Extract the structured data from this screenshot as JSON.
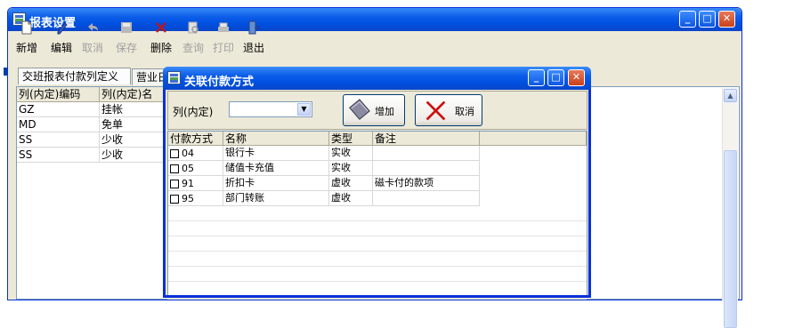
{
  "main_window": {
    "title": "报表设置",
    "toolbar": [
      {
        "label": "新增",
        "icon": "new-file-icon",
        "enabled": true
      },
      {
        "label": "编辑",
        "icon": "edit-pen-icon",
        "enabled": true
      },
      {
        "label": "取消",
        "icon": "undo-icon",
        "enabled": false
      },
      {
        "label": "保存",
        "icon": "save-disk-icon",
        "enabled": false
      },
      {
        "label": "删除",
        "icon": "delete-x-icon",
        "enabled": true
      },
      {
        "label": "查询",
        "icon": "query-icon",
        "enabled": false
      },
      {
        "label": "打印",
        "icon": "printer-icon",
        "enabled": false
      },
      {
        "label": "退出",
        "icon": "exit-door-icon",
        "enabled": true
      }
    ],
    "tabs": [
      "交班报表付款列定义",
      "营业日"
    ],
    "grid": {
      "columns": [
        "列(内定)编码",
        "列(内定)名"
      ],
      "rows": [
        [
          "GZ",
          "挂帐"
        ],
        [
          "MD",
          "免单"
        ],
        [
          "SS",
          "少收"
        ],
        [
          "SS",
          "少收"
        ]
      ]
    }
  },
  "dialog": {
    "title": "关联付款方式",
    "filter_label": "列(内定)",
    "filter_value": "",
    "add_label": "增加",
    "cancel_label": "取消",
    "grid": {
      "columns": [
        "付款方式",
        "名称",
        "类型",
        "备注"
      ],
      "rows": [
        {
          "code": "04",
          "name": "银行卡",
          "type": "实收",
          "note": ""
        },
        {
          "code": "05",
          "name": "储值卡充值",
          "type": "实收",
          "note": ""
        },
        {
          "code": "91",
          "name": "折扣卡",
          "type": "虚收",
          "note": "磁卡付的款项"
        },
        {
          "code": "95",
          "name": "部门转账",
          "type": "虚收",
          "note": ""
        }
      ]
    }
  },
  "colors": {
    "titlebar": "#0050e0",
    "window_face": "#ece9d8",
    "delete_red": "#cc1010"
  }
}
